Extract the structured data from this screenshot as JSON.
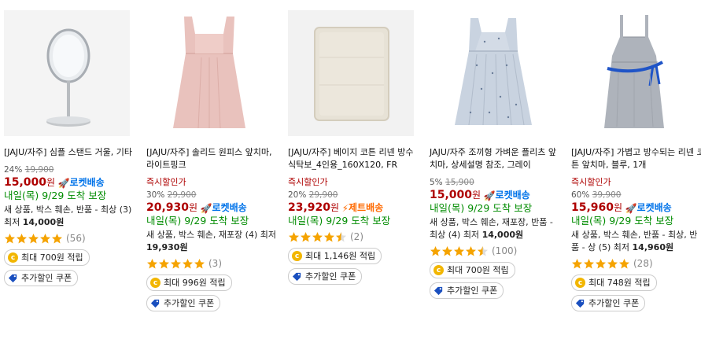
{
  "colors": {
    "discount_red": "#ae0000",
    "rocket_blue": "#0073e9",
    "jet_orange": "#ff6a00",
    "delivery_green": "#008c00",
    "star": "#f5a300",
    "coin": "#f2b600"
  },
  "icons": [
    "rocket-icon",
    "jet-icon",
    "star-icon",
    "coin-icon",
    "coupon-tag-icon"
  ],
  "products": [
    {
      "name": "[JAJU/자주] 심플 스탠드 거울, 기타",
      "instant_tag": "",
      "discount_rate": "24%",
      "base_price": "19,900",
      "price": "15,000",
      "won": "원",
      "badge": "로켓배송",
      "delivery": "내일(목) 9/29 도착 보장",
      "condition_prefix": "새 상품, 박스 훼손, 반품 - 최상 (3) 최저",
      "condition_price": "14,000원",
      "rating": 5,
      "review_count": "(56)",
      "reward": "최대 700원 적립",
      "coupon": "추가할인 쿠폰"
    },
    {
      "name": "[JAJU/자주] 솔리드 원피스 앞치마, 라이트핑크",
      "instant_tag": "즉시할인가",
      "discount_rate": "30%",
      "base_price": "29,900",
      "price": "20,930",
      "won": "원",
      "badge": "로켓배송",
      "delivery": "내일(목) 9/29 도착 보장",
      "condition_prefix": "새 상품, 박스 훼손, 재포장 (4) 최저",
      "condition_price": "19,930원",
      "rating": 5,
      "review_count": "(3)",
      "reward": "최대 996원 적립",
      "coupon": "추가할인 쿠폰"
    },
    {
      "name": "[JAJU/자주] 베이지 코튼 리넨 방수 식탁보_4인용_160X120, FR",
      "instant_tag": "즉시할인가",
      "discount_rate": "20%",
      "base_price": "29,900",
      "price": "23,920",
      "won": "원",
      "badge": "제트배송",
      "delivery": "내일(목) 9/29 도착 보장",
      "condition_prefix": "",
      "condition_price": "",
      "rating": 4.5,
      "review_count": "(2)",
      "reward": "최대 1,146원 적립",
      "coupon": "추가할인 쿠폰"
    },
    {
      "name": "JAJU/자주 조끼형 가벼운 플리츠 앞치마, 상세설명 참조, 그레이",
      "instant_tag": "",
      "discount_rate": "5%",
      "base_price": "15,900",
      "price": "15,000",
      "won": "원",
      "badge": "로켓배송",
      "delivery": "내일(목) 9/29 도착 보장",
      "condition_prefix": "새 상품, 박스 훼손, 재포장, 반품 - 최상 (4) 최저",
      "condition_price": "14,000원",
      "rating": 4.5,
      "review_count": "(100)",
      "reward": "최대 700원 적립",
      "coupon": "추가할인 쿠폰"
    },
    {
      "name": "[JAJU/자주] 가볍고 방수되는 리넨 코튼 앞치마, 블루, 1개",
      "instant_tag": "즉시할인가",
      "discount_rate": "60%",
      "base_price": "39,900",
      "price": "15,960",
      "won": "원",
      "badge": "로켓배송",
      "delivery": "내일(목) 9/29 도착 보장",
      "condition_prefix": "새 상품, 박스 훼손, 반품 - 최상, 반품 - 상 (5) 최저",
      "condition_price": "14,960원",
      "rating": 5,
      "review_count": "(28)",
      "reward": "최대 748원 적립",
      "coupon": "추가할인 쿠폰"
    }
  ]
}
